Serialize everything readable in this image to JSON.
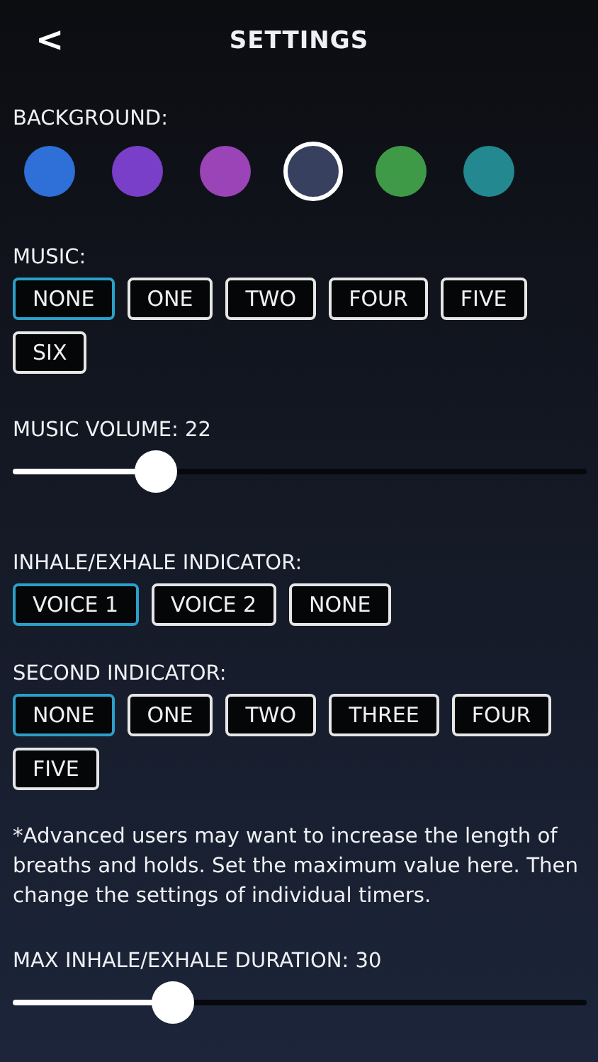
{
  "header": {
    "back": "<",
    "title": "SETTINGS"
  },
  "background": {
    "label": "BACKGROUND:",
    "swatches": [
      {
        "color": "#2f6fd8",
        "selected": false
      },
      {
        "color": "#7a3fc8",
        "selected": false
      },
      {
        "color": "#9a44b8",
        "selected": false
      },
      {
        "color": "#37405e",
        "selected": true
      },
      {
        "color": "#3f9a48",
        "selected": false
      },
      {
        "color": "#23888f",
        "selected": false
      }
    ]
  },
  "music": {
    "label": "MUSIC:",
    "options": [
      {
        "label": "NONE",
        "selected": true
      },
      {
        "label": "ONE",
        "selected": false
      },
      {
        "label": "TWO",
        "selected": false
      },
      {
        "label": "FOUR",
        "selected": false
      },
      {
        "label": "FIVE",
        "selected": false
      },
      {
        "label": "SIX",
        "selected": false
      }
    ]
  },
  "music_volume": {
    "label": "MUSIC VOLUME: 22",
    "level": 0.25
  },
  "inhale_exhale_indicator": {
    "label": "INHALE/EXHALE INDICATOR:",
    "options": [
      {
        "label": "VOICE 1",
        "selected": true
      },
      {
        "label": "VOICE 2",
        "selected": false
      },
      {
        "label": "NONE",
        "selected": false
      }
    ]
  },
  "second_indicator": {
    "label": "SECOND INDICATOR:",
    "options": [
      {
        "label": "NONE",
        "selected": true
      },
      {
        "label": "ONE",
        "selected": false
      },
      {
        "label": "TWO",
        "selected": false
      },
      {
        "label": "THREE",
        "selected": false
      },
      {
        "label": "FOUR",
        "selected": false
      },
      {
        "label": "FIVE",
        "selected": false
      }
    ]
  },
  "note": "*Advanced users may want to increase the length of breaths and holds. Set the maximum value here. Then change the settings of individual timers.",
  "max_duration": {
    "label": "MAX INHALE/EXHALE DURATION: 30",
    "level": 0.28
  }
}
